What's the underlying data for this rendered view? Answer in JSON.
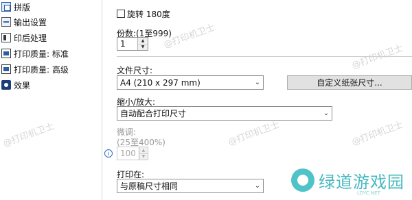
{
  "sidebar": {
    "items": [
      {
        "label": "拼版",
        "icon": "layout-icon"
      },
      {
        "label": "输出设置",
        "icon": "output-settings-icon"
      },
      {
        "label": "印后处理",
        "icon": "post-processing-icon"
      },
      {
        "label": "打印质量: 标准",
        "icon": "print-quality-icon"
      },
      {
        "label": "打印质量: 高级",
        "icon": "print-quality-icon"
      },
      {
        "label": "效果",
        "icon": "effects-icon"
      }
    ]
  },
  "main": {
    "rotate_label": "旋转 180度",
    "rotate_checked": false,
    "copies_label": "份数:(1至999)",
    "copies_value": "1",
    "paper_size_label": "文件尺寸:",
    "paper_size_value": "A4 (210 x 297 mm)",
    "custom_size_button": "自定义纸张尺寸...",
    "scale_label": "缩小/放大:",
    "scale_value": "自动配合打印尺寸",
    "fine_tune_label": "微调:",
    "fine_tune_range": "(25至400%)",
    "fine_tune_value": "100",
    "print_on_label": "打印在:",
    "print_on_value": "与原稿尺寸相同"
  },
  "watermark_text": "@打印机卫士",
  "logo": {
    "text": "绿道游戏园",
    "sub": "LDYC.NET"
  },
  "colors": {
    "accent": "#2b5fa5",
    "logo": "#46b9c0",
    "watermark": "#d6d6d6"
  }
}
